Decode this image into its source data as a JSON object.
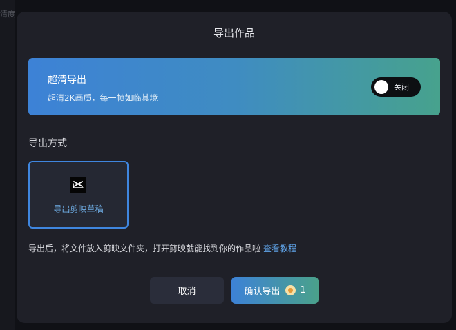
{
  "background": {
    "side_text": "清度"
  },
  "dialog": {
    "title": "导出作品",
    "hd_export": {
      "title": "超清导出",
      "description": "超清2K画质，每一帧如临其境",
      "toggle_label": "关闭",
      "toggle_on": false
    },
    "export_method": {
      "section_title": "导出方式",
      "option_label": "导出剪映草稿",
      "option_icon": "capcut-icon",
      "selected": true
    },
    "hint": {
      "text": "导出后，将文件放入剪映文件夹，打开剪映就能找到你的作品啦",
      "link": "查看教程"
    },
    "buttons": {
      "cancel": "取消",
      "confirm": "确认导出",
      "cost": "1",
      "cost_icon": "coin-icon"
    }
  },
  "colors": {
    "accent_blue": "#3f86df",
    "accent_green": "#47a28d",
    "dialog_bg": "#1f2028"
  }
}
